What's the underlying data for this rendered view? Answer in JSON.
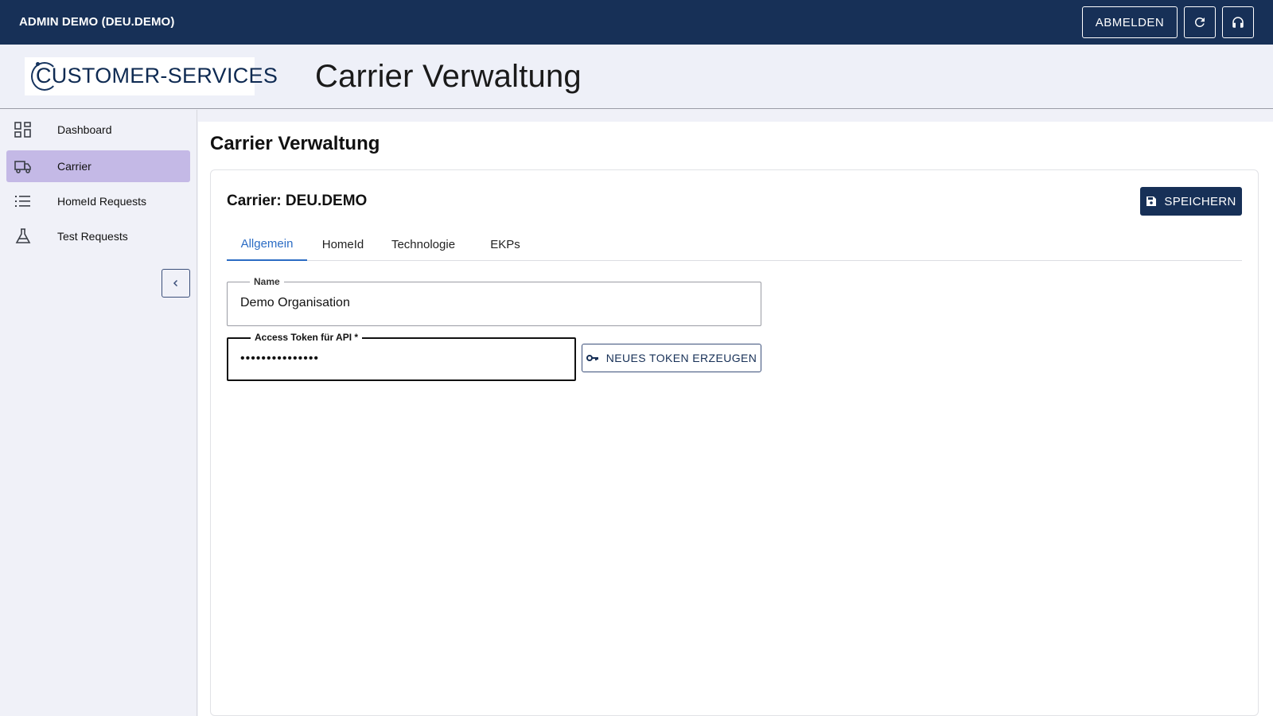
{
  "topbar": {
    "user_label": "ADMIN DEMO (DEU.DEMO)",
    "logout_label": "ABMELDEN",
    "refresh_icon": "refresh-icon",
    "support_icon": "headset-icon"
  },
  "header": {
    "logo_text": "CUSTOMER-SERVICES",
    "title": "Carrier Verwaltung"
  },
  "sidebar": {
    "items": [
      {
        "label": "Dashboard",
        "icon": "dashboard-icon",
        "active": false
      },
      {
        "label": "Carrier",
        "icon": "truck-icon",
        "active": true
      },
      {
        "label": "HomeId Requests",
        "icon": "list-icon",
        "active": false
      },
      {
        "label": "Test Requests",
        "icon": "flask-icon",
        "active": false
      }
    ],
    "collapse_icon": "chevron-left-icon"
  },
  "main": {
    "title": "Carrier Verwaltung",
    "card_title": "Carrier: DEU.DEMO",
    "save_label": "SPEICHERN",
    "tabs": [
      {
        "label": "Allgemein",
        "active": true
      },
      {
        "label": "HomeId",
        "active": false
      },
      {
        "label": "Technologie",
        "active": false
      },
      {
        "label": "EKPs",
        "active": false
      }
    ],
    "name_field": {
      "label": "Name",
      "value": "Demo Organisation"
    },
    "token_field": {
      "label": "Access Token für API *",
      "value": "•••••••••••••••"
    },
    "generate_label": "NEUES TOKEN ERZEUGEN"
  },
  "colors": {
    "topbar": "#173057",
    "accent": "#2b6cc4",
    "active_nav": "#c4b9e6"
  }
}
